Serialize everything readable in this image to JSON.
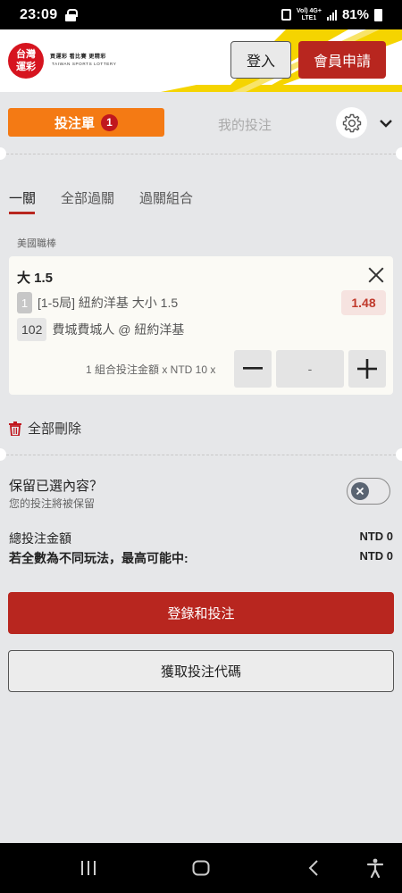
{
  "status_bar": {
    "time": "23:09",
    "net_top": "Vol) 4G+",
    "net_bottom": "LTE1",
    "battery": "81%"
  },
  "header": {
    "logo_main_line1": "台灣",
    "logo_main_line2": "運彩",
    "logo_tagline": "買運彩 看比賽 更精彩",
    "logo_english": "TAIWAN SPORTS LOTTERY",
    "login_label": "登入",
    "register_label": "會員申請"
  },
  "betslip": {
    "tab_betslip": "投注單",
    "tab_betslip_count": "1",
    "tab_mybets": "我的投注",
    "subtabs": [
      "一關",
      "全部過關",
      "過關組合"
    ],
    "league": "美國職棒",
    "selection": {
      "title": "大 1.5",
      "market_num": "1",
      "market_text": "[1-5局] 紐約洋基 大小 1.5",
      "odds": "1.48",
      "event_num": "102",
      "event_text": "費城費城人 @ 紐約洋基"
    },
    "stake_label": "1 組合投注金額 x NTD 10 x",
    "stake_value": "-",
    "delete_all": "全部刪除",
    "keep_title": "保留已選內容？",
    "keep_sub": "您的投注將被保留",
    "total_label": "總投注金額",
    "total_value": "NTD 0",
    "max_win_label": "若全數為不同玩法，最高可能中:",
    "max_win_value": "NTD 0",
    "login_bet_button": "登錄和投注",
    "get_code_button": "獲取投注代碼"
  },
  "colors": {
    "brand_red": "#b8261f",
    "orange": "#f47a14",
    "odds_red": "#c0392b",
    "stripe_yellow": "#f5d400"
  }
}
